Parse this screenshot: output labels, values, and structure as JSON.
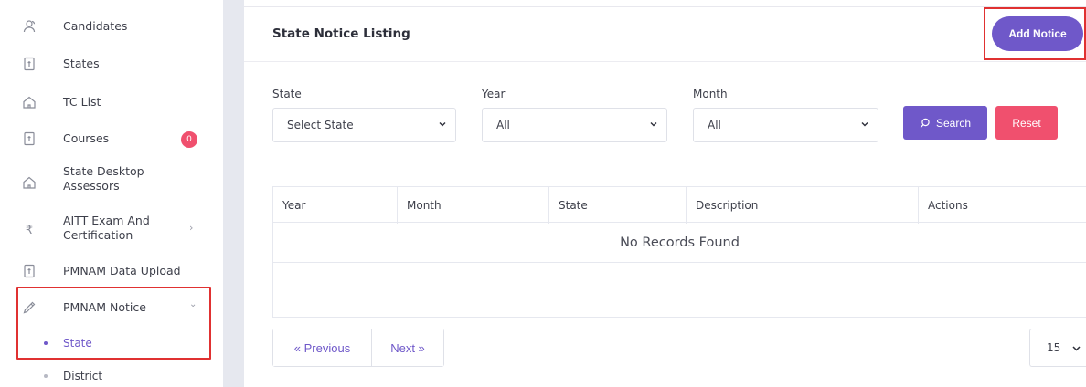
{
  "sidebar": {
    "items": [
      {
        "label": "Candidates",
        "icon": "users-icon"
      },
      {
        "label": "States",
        "icon": "document-icon"
      },
      {
        "label": "TC List",
        "icon": "home-icon"
      },
      {
        "label": "Courses",
        "icon": "document-icon",
        "badge": "0"
      },
      {
        "label": "State Desktop Assessors",
        "icon": "home-icon"
      },
      {
        "label": "AITT Exam And Certification",
        "icon": "rupee-icon"
      },
      {
        "label": "PMNAM Data Upload",
        "icon": "document-icon"
      },
      {
        "label": "PMNAM Notice",
        "icon": "pencil-icon"
      }
    ],
    "sub_items": [
      {
        "label": "State",
        "active": true
      },
      {
        "label": "District",
        "active": false
      }
    ]
  },
  "main": {
    "title": "State Notice Listing",
    "add_button": "Add Notice",
    "filters": {
      "state_label": "State",
      "state_value": "Select State",
      "year_label": "Year",
      "year_value": "All",
      "month_label": "Month",
      "month_value": "All"
    },
    "search_button": "Search",
    "reset_button": "Reset",
    "table": {
      "columns": [
        "Year",
        "Month",
        "State",
        "Description",
        "Actions"
      ],
      "empty_message": "No Records Found"
    },
    "pagination": {
      "previous": "« Previous",
      "next": "Next »",
      "per_page": "15"
    }
  },
  "colors": {
    "primary": "#6f58c9",
    "danger": "#f0506e",
    "highlight": "#e03131"
  }
}
